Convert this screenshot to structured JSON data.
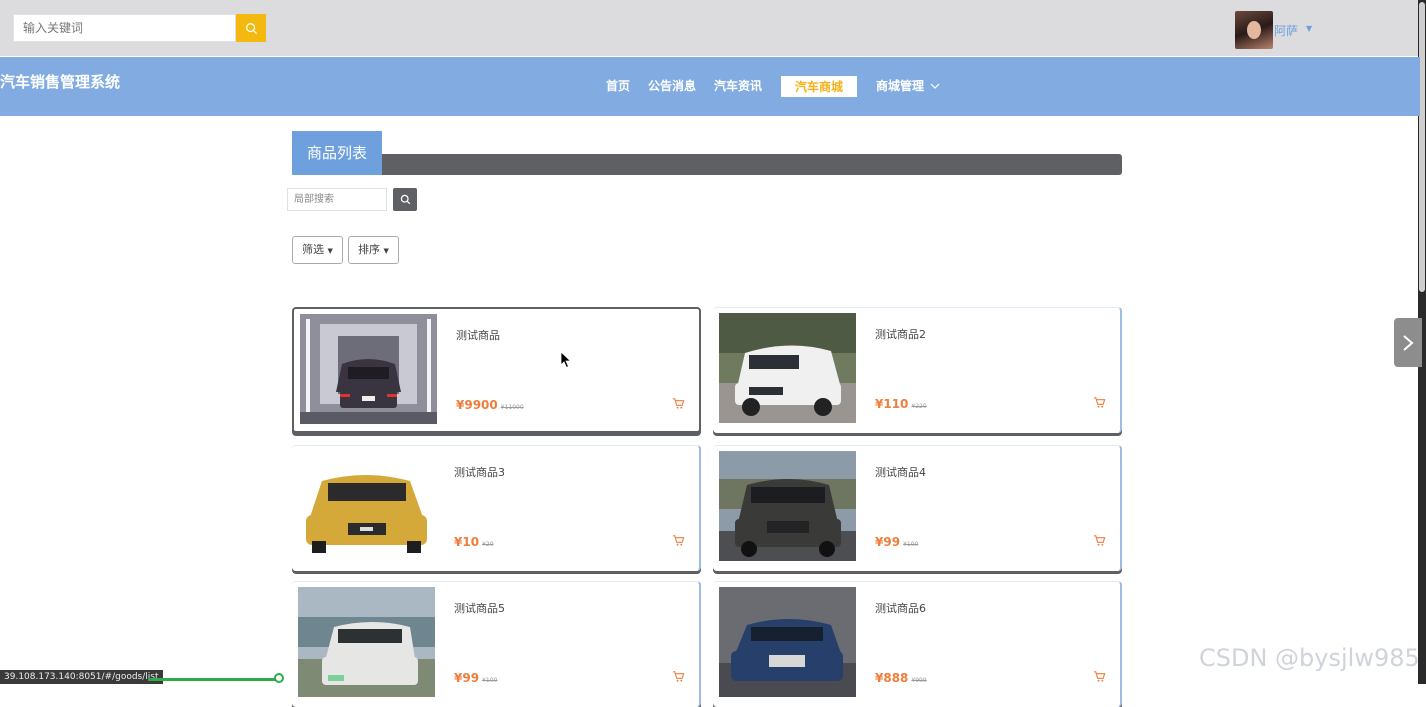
{
  "header": {
    "search_placeholder": "输入关键词",
    "username": "阿萨"
  },
  "nav": {
    "brand": "汽车销售管理系统",
    "items": [
      {
        "label": "首页"
      },
      {
        "label": "公告消息"
      },
      {
        "label": "汽车资讯"
      },
      {
        "label": "汽车商城"
      },
      {
        "label": "商城管理"
      }
    ],
    "active_index": 3
  },
  "section": {
    "title": "商品列表",
    "local_search_placeholder": "局部搜索",
    "filter_label": "筛选",
    "sort_label": "排序"
  },
  "products": [
    {
      "name": "测试商品",
      "price": "¥9900",
      "old_price": "¥11000",
      "car_color": "#3a3440"
    },
    {
      "name": "测试商品2",
      "price": "¥110",
      "old_price": "¥220",
      "car_color": "#f0f0f0"
    },
    {
      "name": "测试商品3",
      "price": "¥10",
      "old_price": "¥20",
      "car_color": "#d4a93a"
    },
    {
      "name": "测试商品4",
      "price": "¥99",
      "old_price": "¥100",
      "car_color": "#3a3a38"
    },
    {
      "name": "测试商品5",
      "price": "¥99",
      "old_price": "¥100",
      "car_color": "#e6e6e4"
    },
    {
      "name": "测试商品6",
      "price": "¥888",
      "old_price": "¥999",
      "car_color": "#27406b"
    }
  ],
  "footer": {
    "watermark": "CSDN @bysjlw985",
    "status_url": "39.108.173.140:8051/#/goods/list"
  },
  "colors": {
    "nav_bg": "#82ace1",
    "accent": "#f3b90e",
    "price": "#ef7d3c",
    "section_title_bg": "#6fa0de"
  }
}
